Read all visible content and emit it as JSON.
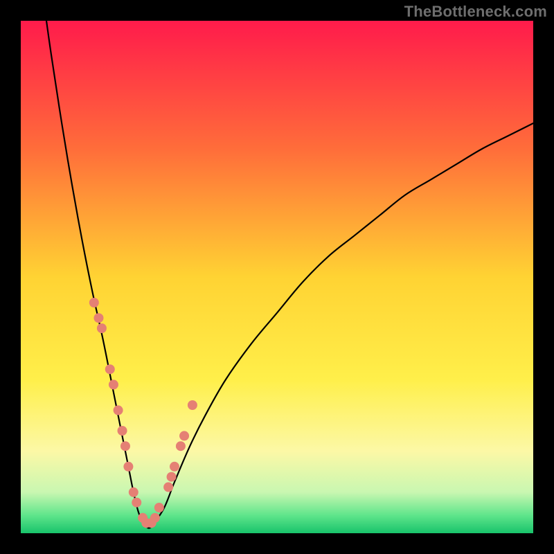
{
  "watermark": "TheBottleneck.com",
  "chart_data": {
    "type": "line",
    "title": "",
    "xlabel": "",
    "ylabel": "",
    "xlim": [
      0,
      100
    ],
    "ylim": [
      0,
      100
    ],
    "grid": false,
    "legend": false,
    "background_gradient": {
      "stops": [
        {
          "offset": 0.0,
          "color": "#ff1b4b"
        },
        {
          "offset": 0.25,
          "color": "#ff6d3a"
        },
        {
          "offset": 0.5,
          "color": "#ffd333"
        },
        {
          "offset": 0.7,
          "color": "#ffef4a"
        },
        {
          "offset": 0.84,
          "color": "#fcf8a6"
        },
        {
          "offset": 0.92,
          "color": "#c9f7b1"
        },
        {
          "offset": 0.965,
          "color": "#5fe58b"
        },
        {
          "offset": 1.0,
          "color": "#18c36b"
        }
      ]
    },
    "series": [
      {
        "name": "bottleneck-curve",
        "color": "#000000",
        "stroke_width": 2.2,
        "x": [
          5,
          6,
          8,
          10,
          12,
          14,
          16,
          18,
          19,
          20,
          21,
          22,
          23,
          24,
          25,
          26,
          28,
          30,
          33,
          36,
          40,
          45,
          50,
          55,
          60,
          65,
          70,
          75,
          80,
          85,
          90,
          95,
          100
        ],
        "y": [
          100,
          93,
          80,
          68,
          57,
          47,
          38,
          28,
          23,
          18,
          13,
          8,
          4,
          2,
          1,
          2,
          5,
          10,
          17,
          23,
          30,
          37,
          43,
          49,
          54,
          58,
          62,
          66,
          69,
          72,
          75,
          77.5,
          80
        ]
      }
    ],
    "markers": [
      {
        "name": "salmon-beads",
        "color": "#e58074",
        "radius": 7,
        "x": [
          14.3,
          15.2,
          15.8,
          17.4,
          18.1,
          19.0,
          19.8,
          20.4,
          21.0,
          22.0,
          22.6,
          23.8,
          24.5,
          25.5,
          26.2,
          27.0,
          28.8,
          29.4,
          30.0,
          31.2,
          31.9,
          33.5
        ],
        "y": [
          45,
          42,
          40,
          32,
          29,
          24,
          20,
          17,
          13,
          8,
          6,
          3,
          2,
          2,
          3,
          5,
          9,
          11,
          13,
          17,
          19,
          25
        ]
      }
    ]
  }
}
